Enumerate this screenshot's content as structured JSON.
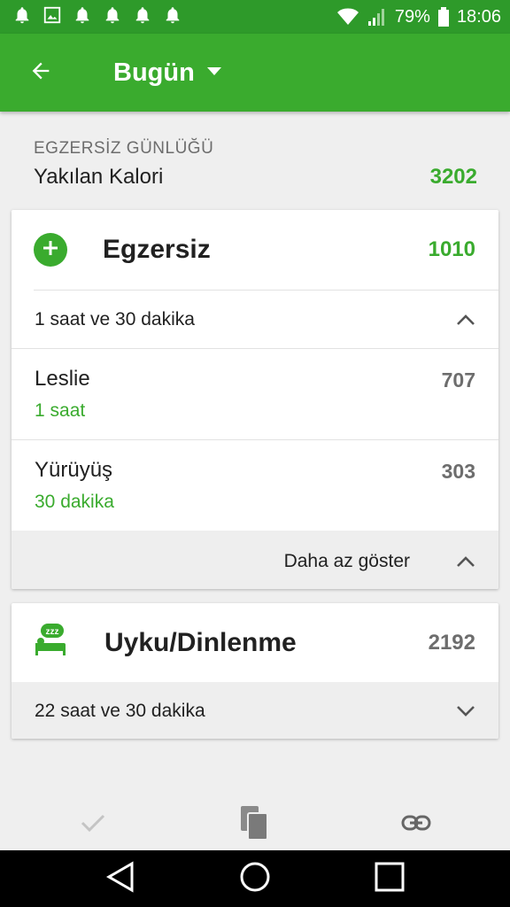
{
  "status_bar": {
    "notification_icons": [
      "bell-icon",
      "image-icon",
      "bell-icon",
      "bell-icon",
      "bell-icon",
      "bell-icon"
    ],
    "battery": "79%",
    "time": "18:06"
  },
  "app_bar": {
    "title": "Bugün",
    "back_icon": "arrow-left-icon",
    "dropdown_icon": "caret-down-icon"
  },
  "summary": {
    "section_label": "EGZERSİZ GÜNLÜĞÜ",
    "calories_label": "Yakılan Kalori",
    "calories_value": "3202"
  },
  "exercise_card": {
    "title": "Egzersiz",
    "value": "1010",
    "duration_summary": "1 saat ve 30 dakika",
    "entries": [
      {
        "name": "Leslie",
        "duration": "1 saat",
        "calories": "707"
      },
      {
        "name": "Yürüyüş",
        "duration": "30 dakika",
        "calories": "303"
      }
    ],
    "show_less_label": "Daha az göster"
  },
  "sleep_card": {
    "title": "Uyku/Dinlenme",
    "value": "2192",
    "duration_summary": "22 saat ve 30 dakika"
  },
  "bottom_actions": {
    "icons": [
      "check-icon",
      "copy-icon",
      "link-icon"
    ]
  },
  "colors": {
    "primary": "#3aab2e",
    "status_bar": "#2e9a2a",
    "muted_text": "#6d6d6d"
  }
}
